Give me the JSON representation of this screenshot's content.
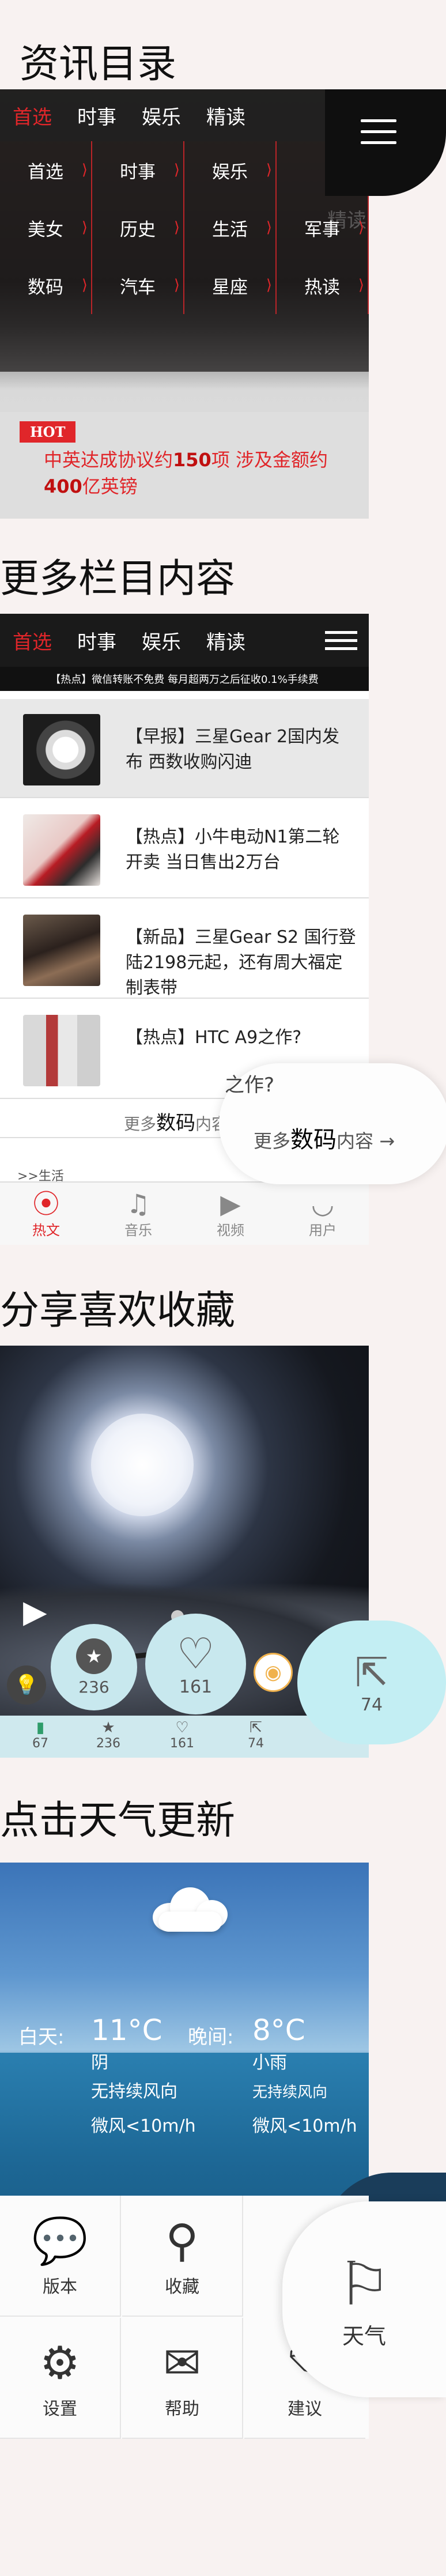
{
  "sections": [
    {
      "title": "资讯目录"
    },
    {
      "title": "更多栏目内容"
    },
    {
      "title": "分享喜欢收藏"
    },
    {
      "title": "点击天气更新"
    }
  ],
  "s1": {
    "tabs": [
      "首选",
      "时事",
      "娱乐",
      "精读"
    ],
    "side_text": "精读",
    "grid": [
      "首选",
      "时事",
      "娱乐",
      "",
      "美女",
      "历史",
      "生活",
      "军事",
      "数码",
      "汽车",
      "星座",
      "热读"
    ],
    "hot_tag": "HOT",
    "news_plain": "中英达成协议约",
    "news_bold1": "150",
    "news_mid": "项 涉及金额约",
    "news_bold2": "400",
    "news_tail": "亿英镑"
  },
  "s2": {
    "tabs": [
      "首选",
      "时事",
      "娱乐",
      "精读"
    ],
    "ticker": "【热点】微信转账不免费 每月超两万之后征收0.1%手续费",
    "news": [
      {
        "text": "【早报】三星Gear 2国内发布 西数收购闪迪"
      },
      {
        "text": "【热点】小牛电动N1第二轮开卖 当日售出2万台"
      },
      {
        "text": "【新品】三星Gear S2 国行登陆2198元起，还有周大福定制表带"
      },
      {
        "text": "【热点】HTC A9之作?"
      }
    ],
    "bubble_top": "之作?",
    "more_prefix": "更多",
    "more_bold": "数码",
    "more_suffix": "内容",
    "more_arrow": "→",
    "breadcrumb": ">>生活",
    "bottom_tabs": [
      {
        "label": "热文",
        "icon": "rss-icon"
      },
      {
        "label": "音乐",
        "icon": "music-icon"
      },
      {
        "label": "视频",
        "icon": "video-icon"
      },
      {
        "label": "用户",
        "icon": "user-icon"
      }
    ]
  },
  "s3": {
    "star_count": "236",
    "heart_count": "161",
    "share_count": "74",
    "strip_counts": [
      "67",
      "236",
      "161",
      "74"
    ]
  },
  "s4": {
    "day_label": "白天:",
    "day_temp": "11°C",
    "day_cond": "阴",
    "day_wind": "无持续风向",
    "day_wind2": "微风<10m/h",
    "night_label": "晚间:",
    "night_temp": "8°C",
    "night_cond": "小雨",
    "night_wind": "无持续风向",
    "night_wind2": "微风<10m/h",
    "menu": [
      "版本",
      "收藏",
      "设置",
      "帮助",
      "建议"
    ],
    "big_label": "天气"
  },
  "colors": {
    "accent": "#e0262a",
    "dark": "#1a1a1a",
    "strip": "#c8e8ee"
  }
}
